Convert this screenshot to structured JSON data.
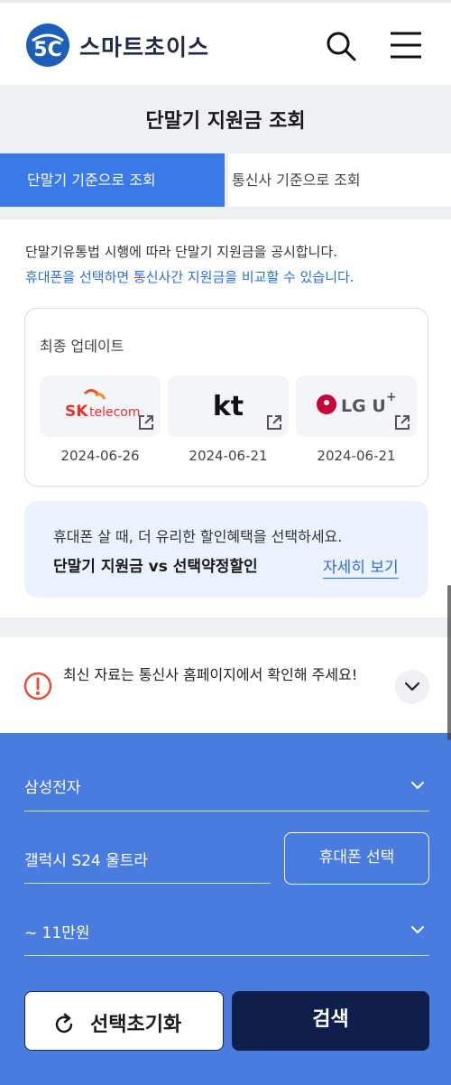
{
  "header": {
    "brand": "스마트초이스",
    "logo_icon": "smartchoice-logo-icon",
    "search_icon": "search-icon",
    "menu_icon": "hamburger-menu-icon"
  },
  "page": {
    "title": "단말기 지원금 조회"
  },
  "tabs": [
    {
      "label": "단말기 기준으로 조회",
      "active": true
    },
    {
      "label": "통신사 기준으로 조회",
      "active": false
    }
  ],
  "notice": {
    "line1": "단말기유통법 시행에 따라 단말기 지원금을 공시합니다.",
    "line2": "휴대폰을 선택하면 통신사간 지원금을 비교할 수 있습니다."
  },
  "update": {
    "heading": "최종 업데이트",
    "carriers": [
      {
        "name": "SK telecom",
        "date": "2024-06-26"
      },
      {
        "name": "kt",
        "date": "2024-06-21"
      },
      {
        "name": "LG U+",
        "date": "2024-06-21"
      }
    ]
  },
  "promo": {
    "line1": "휴대폰 살 때, 더 유리한 할인혜택을 선택하세요.",
    "line2": "단말기 지원금 vs 선택약정할인",
    "link": "자세히 보기"
  },
  "alert": {
    "text": "최신 자료는 통신사 홈페이지에서 확인해 주세요!"
  },
  "search": {
    "manufacturer": "삼성전자",
    "model": "갤럭시 S24 울트라",
    "select_phone_label": "휴대폰 선택",
    "price": "~ 11만원",
    "reset_label": "선택초기화",
    "submit_label": "검색"
  },
  "colors": {
    "primary": "#3a7ae8",
    "panel": "#4a7ce0",
    "navy": "#0f1f4b",
    "link": "#2b6fd6",
    "alert": "#e0503a"
  }
}
